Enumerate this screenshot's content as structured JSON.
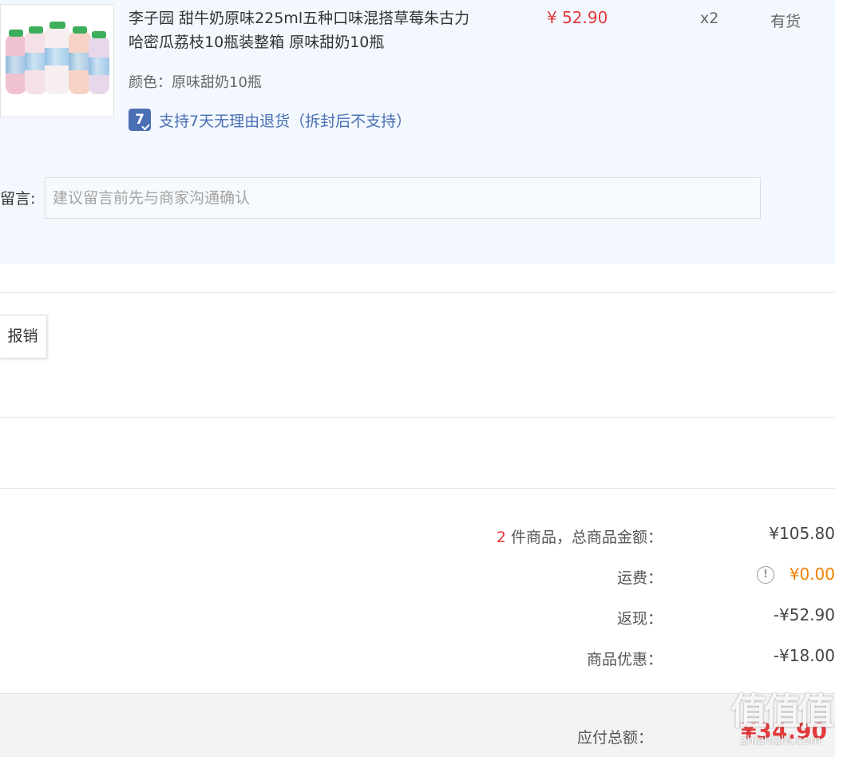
{
  "product": {
    "title": "李子园 甜牛奶原味225ml五种口味混搭草莓朱古力哈密瓜荔枝10瓶装整箱 原味甜奶10瓶",
    "price": "¥ 52.90",
    "quantity": "x2",
    "stock": "有货",
    "color_label": "颜色：",
    "color_value": "原味甜奶10瓶",
    "return_badge": "7",
    "return_policy": "支持7天无理由退货（拆封后不支持）",
    "remark_label": "留言:",
    "remark_placeholder": "建议留言前先与商家沟通确认"
  },
  "reimburse_button": "报销",
  "summary": {
    "count": "2",
    "items_label": " 件商品，总商品金额：",
    "items_total": "¥105.80",
    "shipping_label": "运费：",
    "shipping_value": "¥0.00",
    "cashback_label": "返现：",
    "cashback_value": "-¥52.90",
    "discount_label": "商品优惠：",
    "discount_value": "-¥18.00",
    "payable_label": "应付总额：",
    "payable_value": "¥34.90"
  },
  "watermark": {
    "logo": "值值值",
    "url": "zhizhizhi.com"
  },
  "colors": {
    "accent_red": "#e4393c",
    "accent_orange": "#f08200",
    "link_blue": "#4b6fb5",
    "panel_bg": "#f2f8fe"
  }
}
